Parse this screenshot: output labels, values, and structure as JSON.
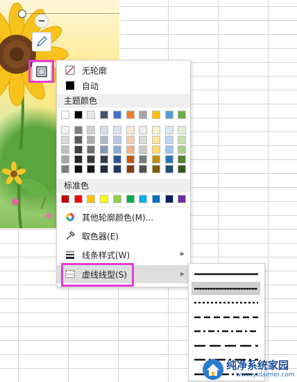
{
  "menu": {
    "no_outline": "无轮廓",
    "auto": "自动",
    "theme_colors_header": "主题颜色",
    "standard_colors_header": "标准色",
    "other_colors": "其他轮廓颜色(M)...",
    "eyedropper": "取色器(E)",
    "line_style": "线条样式(W)",
    "dash_type": "虚线线型(S)"
  },
  "theme_colors": {
    "top_row": [
      "#ffffff",
      "#000000",
      "#e7e6e6",
      "#44546a",
      "#4472c4",
      "#ed7d31",
      "#a5a5a5",
      "#ffc000",
      "#5b9bd5",
      "#70ad47"
    ],
    "shade_rows": [
      [
        "#f2f2f2",
        "#7f7f7f",
        "#d0cece",
        "#d6dce4",
        "#d9e2f3",
        "#fbe5d5",
        "#ededed",
        "#fff2cc",
        "#deebf6",
        "#e2efd9"
      ],
      [
        "#d8d8d8",
        "#595959",
        "#aeabab",
        "#adb9ca",
        "#b4c6e7",
        "#f7cbac",
        "#dbdbdb",
        "#fee599",
        "#bdd7ee",
        "#c5e0b3"
      ],
      [
        "#bfbfbf",
        "#3f3f3f",
        "#757070",
        "#8496b0",
        "#8eaadb",
        "#f4b183",
        "#c9c9c9",
        "#ffd965",
        "#9dc3e6",
        "#a8d08d"
      ],
      [
        "#a5a5a5",
        "#262626",
        "#3a3838",
        "#323f4f",
        "#2f5496",
        "#c55a11",
        "#7b7b7b",
        "#bf9000",
        "#2e75b5",
        "#538135"
      ],
      [
        "#7f7f7f",
        "#0c0c0c",
        "#171616",
        "#222a35",
        "#1f3864",
        "#833c0b",
        "#525252",
        "#7f6000",
        "#1e4e79",
        "#375623"
      ]
    ]
  },
  "standard_colors": [
    "#c00000",
    "#ff0000",
    "#ffc000",
    "#ffff00",
    "#92d050",
    "#00b050",
    "#00b0f0",
    "#0070c0",
    "#002060",
    "#7030a0"
  ],
  "dash_types": [
    "solid",
    "round-dot",
    "square-dot",
    "dash",
    "dash-dot",
    "long-dash",
    "long-dash-dot",
    "long-dash-dot-dot"
  ],
  "selected_dash_type": "round-dot",
  "icons": {
    "pen": "pen-icon",
    "outline": "shape-outline-icon",
    "minus": "minus-icon",
    "eyedropper": "eyedropper-icon",
    "other_colors": "color-wheel-icon",
    "line_style": "line-weight-icon",
    "dash_type": "dash-type-icon"
  },
  "highlight_color": "#e53cd6",
  "watermark": {
    "title": "纯净系统家园",
    "url": "www.yidaimei.com"
  }
}
